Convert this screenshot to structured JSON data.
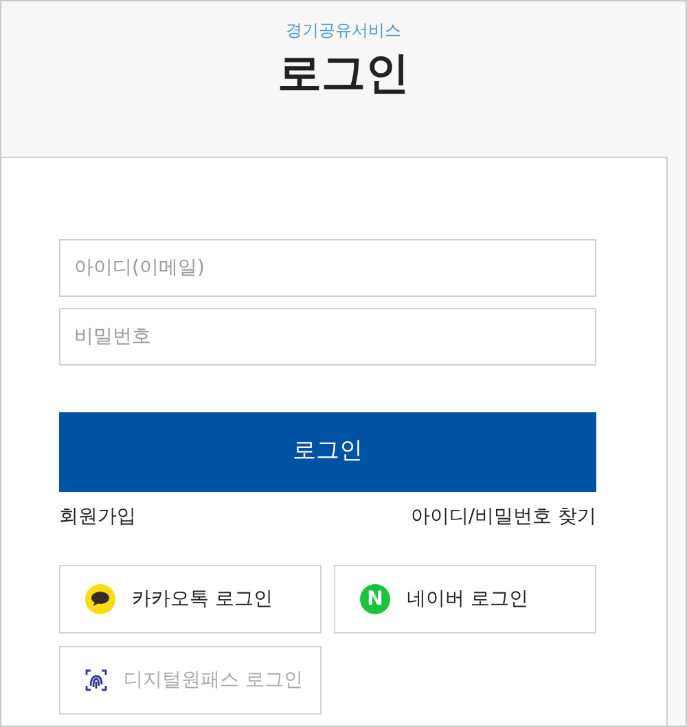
{
  "header": {
    "service_name": "경기공유서비스",
    "title": "로그인"
  },
  "form": {
    "id_field": {
      "placeholder": "아이디(이메일)"
    },
    "password_field": {
      "placeholder": "비밀번호"
    },
    "login_button": "로그인",
    "signup_link": "회원가입",
    "find_link": "아이디/비밀번호 찾기"
  },
  "social_logins": [
    {
      "kind": "kakao",
      "label": "카카오톡 로그인",
      "disabled": false
    },
    {
      "kind": "naver",
      "label": "네이버 로그인",
      "icon_text": "N",
      "disabled": false
    },
    {
      "kind": "digital",
      "label": "디지털원패스 로그인",
      "disabled": true
    }
  ]
}
